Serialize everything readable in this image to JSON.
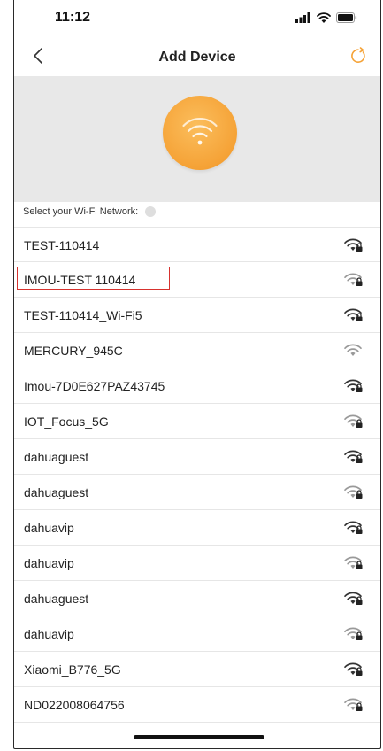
{
  "status_bar": {
    "time": "11:12"
  },
  "nav": {
    "title": "Add Device"
  },
  "section": {
    "select_label": "Select your Wi-Fi Network:"
  },
  "networks": [
    {
      "name": "TEST-110414",
      "locked": true,
      "highlighted": false
    },
    {
      "name": "IMOU-TEST 110414",
      "locked": true,
      "highlighted": true
    },
    {
      "name": "TEST-110414_Wi-Fi5",
      "locked": true,
      "highlighted": false
    },
    {
      "name": "MERCURY_945C",
      "locked": false,
      "highlighted": false
    },
    {
      "name": "Imou-7D0E627PAZ43745",
      "locked": true,
      "highlighted": false
    },
    {
      "name": "IOT_Focus_5G",
      "locked": true,
      "highlighted": false
    },
    {
      "name": "dahuaguest",
      "locked": true,
      "highlighted": false
    },
    {
      "name": "dahuaguest",
      "locked": true,
      "highlighted": false
    },
    {
      "name": "dahuavip",
      "locked": true,
      "highlighted": false
    },
    {
      "name": "dahuavip",
      "locked": true,
      "highlighted": false
    },
    {
      "name": "dahuaguest",
      "locked": true,
      "highlighted": false
    },
    {
      "name": "dahuavip",
      "locked": true,
      "highlighted": false
    },
    {
      "name": "Xiaomi_B776_5G",
      "locked": true,
      "highlighted": false
    },
    {
      "name": "ND022008064756",
      "locked": true,
      "highlighted": false
    }
  ],
  "colors": {
    "accent": "#f5a236",
    "highlight_border": "#d7322e",
    "hero_background": "#e8e8e8"
  },
  "icons": {
    "back": "chevron-left-icon",
    "refresh": "refresh-icon",
    "hero": "wifi-icon",
    "network_locked": "wifi-lock-icon",
    "network_open": "wifi-icon"
  }
}
